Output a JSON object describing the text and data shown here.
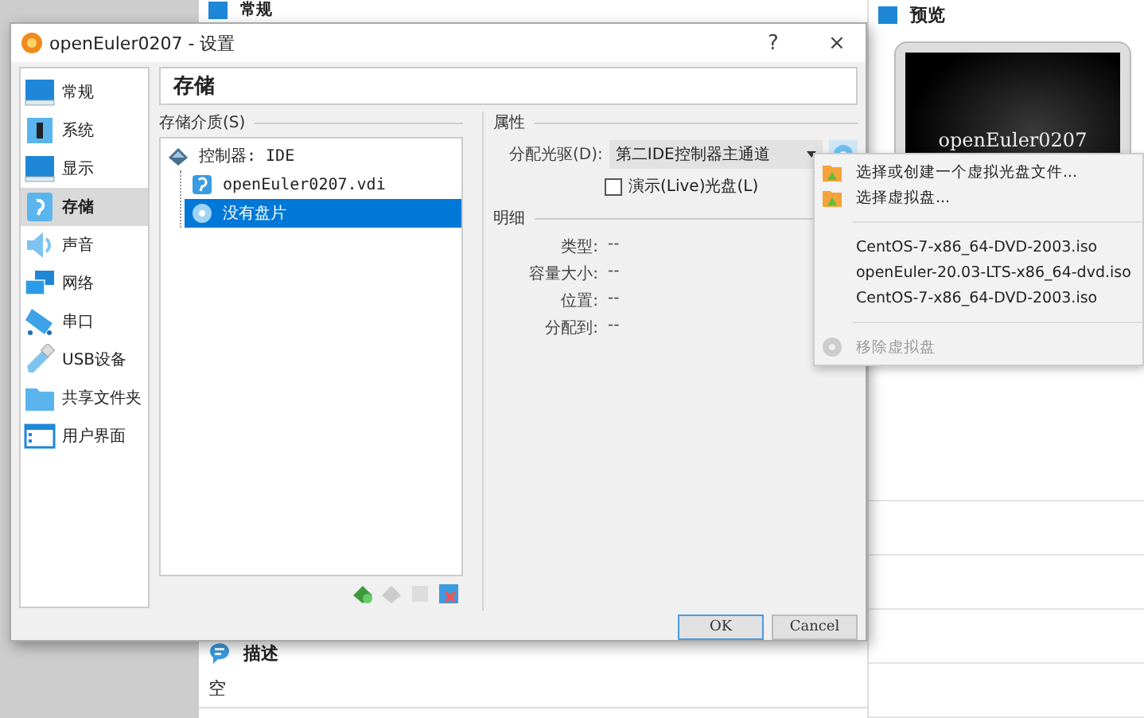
{
  "background_window": {
    "section_header": "常规",
    "preview_header": "预览",
    "preview_text": "openEuler0207",
    "description_header": "描述",
    "description_text": "空"
  },
  "dialog": {
    "title": "openEuler0207 - 设置",
    "help": "?",
    "close": "×",
    "sidebar": [
      {
        "label": "常规",
        "kind": "general",
        "selected": false
      },
      {
        "label": "系统",
        "kind": "system",
        "selected": false
      },
      {
        "label": "显示",
        "kind": "display",
        "selected": false
      },
      {
        "label": "存储",
        "kind": "storage",
        "selected": true
      },
      {
        "label": "声音",
        "kind": "audio",
        "selected": false
      },
      {
        "label": "网络",
        "kind": "network",
        "selected": false
      },
      {
        "label": "串口",
        "kind": "serial",
        "selected": false
      },
      {
        "label": "USB设备",
        "kind": "usb",
        "selected": false
      },
      {
        "label": "共享文件夹",
        "kind": "shared",
        "selected": false
      },
      {
        "label": "用户界面",
        "kind": "ui",
        "selected": false
      }
    ],
    "page_title": "存储",
    "storage_media": {
      "label": "存储介质(S)",
      "tree": [
        {
          "label": "控制器: IDE",
          "kind": "controller",
          "selected": false,
          "children": [
            {
              "label": "openEuler0207.vdi",
              "kind": "hdd",
              "selected": false
            },
            {
              "label": "没有盘片",
              "kind": "optical",
              "selected": true
            }
          ]
        }
      ]
    },
    "attributes": {
      "label": "属性",
      "drive_label": "分配光驱(D):",
      "drive_value": "第二IDE控制器主通道",
      "live_cd": {
        "label": "演示(Live)光盘(L)",
        "checked": false
      }
    },
    "details": {
      "label": "明细",
      "rows": [
        {
          "name": "类型:",
          "value": "--"
        },
        {
          "name": "容量大小:",
          "value": "--"
        },
        {
          "name": "位置:",
          "value": "--"
        },
        {
          "name": "分配到:",
          "value": "--"
        }
      ]
    },
    "buttons": [
      {
        "label": "OK",
        "default": true
      },
      {
        "label": "Cancel",
        "default": false
      }
    ]
  },
  "menu": {
    "items": [
      {
        "kind": "action",
        "label": "选择或创建一个虚拟光盘文件...",
        "disabled": false
      },
      {
        "kind": "action",
        "label": "选择虚拟盘...",
        "disabled": false
      },
      {
        "kind": "separator"
      },
      {
        "kind": "file",
        "label": "CentOS-7-x86_64-DVD-2003.iso"
      },
      {
        "kind": "file",
        "label": "openEuler-20.03-LTS-x86_64-dvd.iso"
      },
      {
        "kind": "file",
        "label": "CentOS-7-x86_64-DVD-2003.iso"
      },
      {
        "kind": "separator"
      },
      {
        "kind": "action",
        "label": "移除虚拟盘",
        "disabled": true
      }
    ]
  }
}
